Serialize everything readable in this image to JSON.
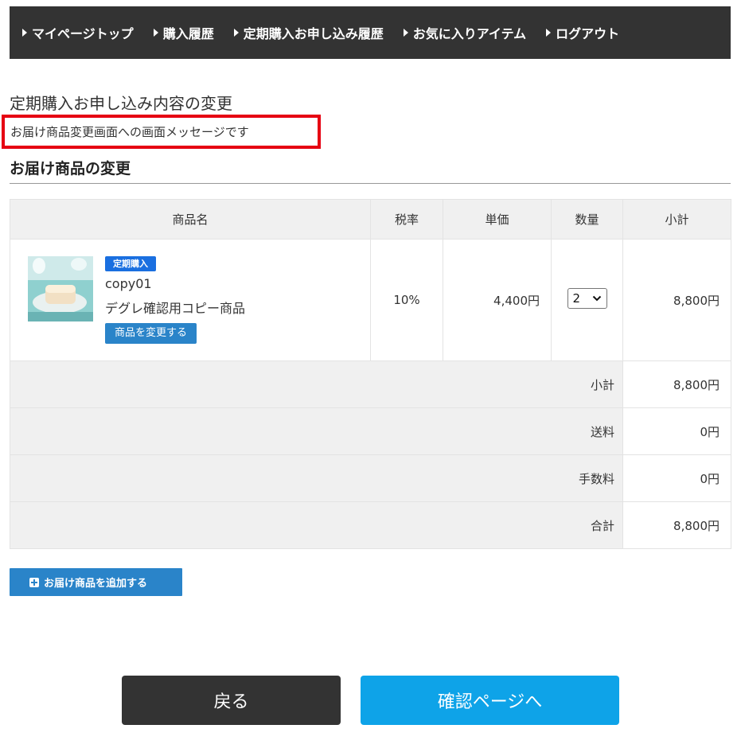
{
  "nav": {
    "items": [
      {
        "label": "マイページトップ"
      },
      {
        "label": "購入履歴"
      },
      {
        "label": "定期購入お申し込み履歴"
      },
      {
        "label": "お気に入りアイテム"
      },
      {
        "label": "ログアウト"
      }
    ]
  },
  "page": {
    "title": "定期購入お申し込み内容の変更",
    "message": "お届け商品変更画面への画面メッセージです",
    "section_title": "お届け商品の変更"
  },
  "table": {
    "headers": {
      "product": "商品名",
      "tax_rate": "税率",
      "unit_price": "単価",
      "quantity": "数量",
      "subtotal": "小計"
    },
    "product": {
      "badge": "定期購入",
      "code": "copy01",
      "name": "デグレ確認用コピー商品",
      "change_label": "商品を変更する",
      "tax_rate": "10%",
      "unit_price": "4,400円",
      "quantity": "2",
      "subtotal": "8,800円"
    },
    "summary": [
      {
        "label": "小計",
        "value": "8,800円"
      },
      {
        "label": "送料",
        "value": "0円"
      },
      {
        "label": "手数料",
        "value": "0円"
      },
      {
        "label": "合計",
        "value": "8,800円"
      }
    ]
  },
  "actions": {
    "add_label": "お届け商品を追加する",
    "back_label": "戻る",
    "confirm_label": "確認ページへ"
  },
  "icons": {
    "nav_arrow": "triangle-right-icon",
    "add": "plus-square-icon",
    "select": "chevron-down-icon"
  },
  "colors": {
    "nav_bg": "#333333",
    "highlight_border": "#e60012",
    "primary_blue": "#2a84c9",
    "badge_blue": "#1a6fe0",
    "confirm_blue": "#0ea3e8",
    "back_dark": "#333333"
  }
}
